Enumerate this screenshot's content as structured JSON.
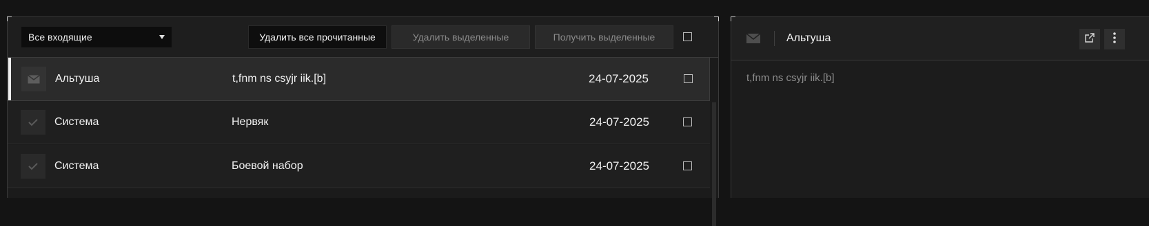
{
  "filter": {
    "selected": "Все входящие"
  },
  "toolbar": {
    "delete_read": "Удалить все прочитанные",
    "delete_selected": "Удалить выделенные",
    "get_selected": "Получить выделенные"
  },
  "messages": [
    {
      "sender": "Альтуша",
      "subject": "t,fnm ns csyjr iik.[b]",
      "date": "24-07-2025",
      "icon": "envelope-icon",
      "selected": true
    },
    {
      "sender": "Система",
      "subject": "Нервяк",
      "date": "24-07-2025",
      "icon": "checkmark-icon"
    },
    {
      "sender": "Система",
      "subject": "Боевой набор",
      "date": "24-07-2025",
      "icon": "checkmark-icon"
    }
  ],
  "preview": {
    "title": "Альтуша",
    "body": "t,fnm ns csyjr iik.[b]",
    "icons": [
      "envelope-icon",
      "external-link-icon",
      "more-vertical-icon"
    ]
  },
  "colors": {
    "background": "#141414",
    "panel": "#1b1b1b",
    "selected_row": "#2b2b2b",
    "accent": "#efefef"
  }
}
